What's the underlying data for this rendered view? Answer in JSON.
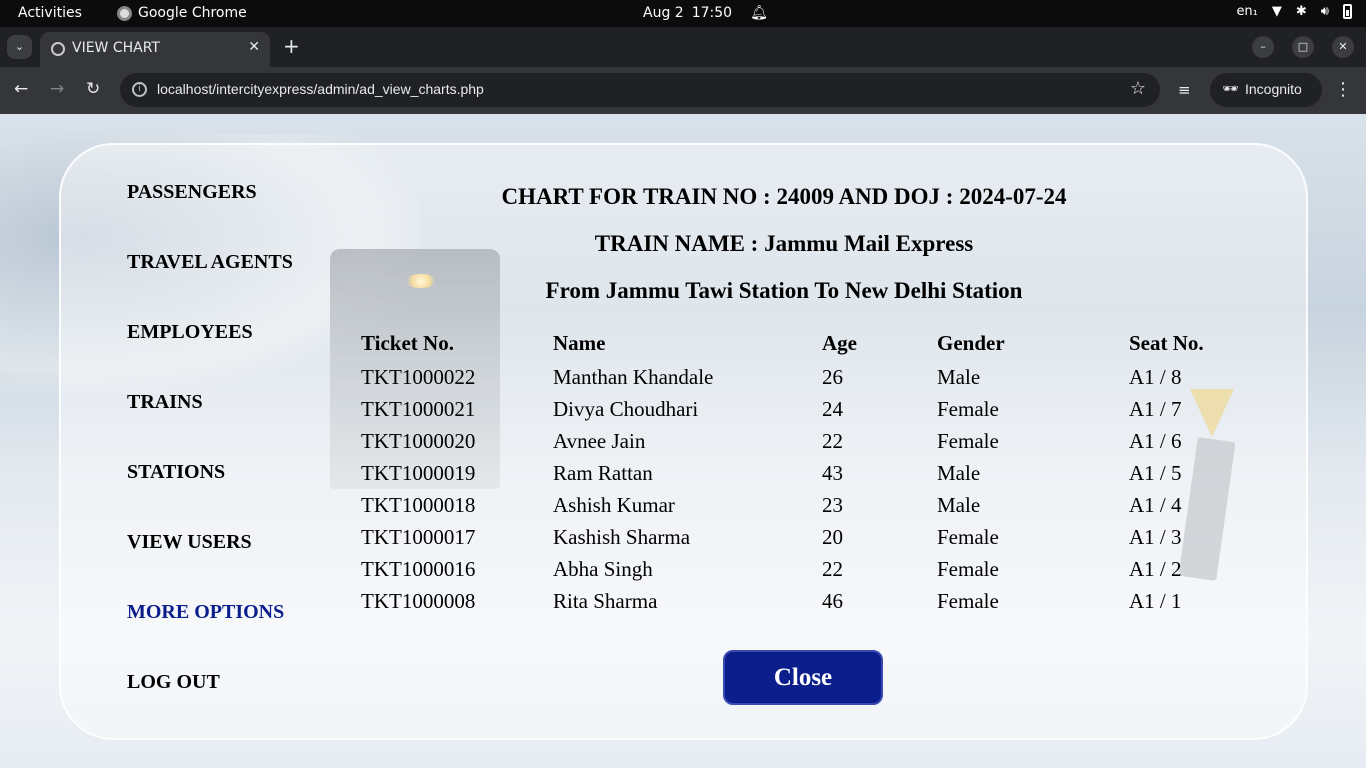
{
  "os": {
    "activities": "Activities",
    "app_name": "Google Chrome",
    "date": "Aug 2",
    "time": "17:50",
    "lang": "en₁"
  },
  "browser": {
    "tab_title": "VIEW CHART",
    "url": "localhost/intercityexpress/admin/ad_view_charts.php",
    "incognito_label": "Incognito"
  },
  "sidebar": {
    "items": [
      {
        "label": "PASSENGERS"
      },
      {
        "label": "TRAVEL AGENTS"
      },
      {
        "label": "EMPLOYEES"
      },
      {
        "label": "TRAINS"
      },
      {
        "label": "STATIONS"
      },
      {
        "label": "VIEW USERS"
      },
      {
        "label": "MORE OPTIONS"
      },
      {
        "label": "LOG OUT"
      }
    ]
  },
  "chart": {
    "heading1": "CHART FOR TRAIN NO : 24009 AND DOJ : 2024-07-24",
    "heading2": "TRAIN NAME : Jammu Mail Express",
    "heading3": "From Jammu Tawi Station To New Delhi Station",
    "columns": [
      "Ticket No.",
      "Name",
      "Age",
      "Gender",
      "Seat No."
    ],
    "rows": [
      [
        "TKT1000022",
        "Manthan Khandale",
        "26",
        "Male",
        "A1 / 8"
      ],
      [
        "TKT1000021",
        "Divya Choudhari",
        "24",
        "Female",
        "A1 / 7"
      ],
      [
        "TKT1000020",
        "Avnee Jain",
        "22",
        "Female",
        "A1 / 6"
      ],
      [
        "TKT1000019",
        "Ram Rattan",
        "43",
        "Male",
        "A1 / 5"
      ],
      [
        "TKT1000018",
        "Ashish Kumar",
        "23",
        "Male",
        "A1 / 4"
      ],
      [
        "TKT1000017",
        "Kashish Sharma",
        "20",
        "Female",
        "A1 / 3"
      ],
      [
        "TKT1000016",
        "Abha Singh",
        "22",
        "Female",
        "A1 / 2"
      ],
      [
        "TKT1000008",
        "Rita Sharma",
        "46",
        "Female",
        "A1 / 1"
      ]
    ],
    "close_label": "Close"
  },
  "colors": {
    "accent": "#0b1e8c",
    "active_link": "#0b1e8c"
  },
  "icons": [
    "chrome-icon",
    "bell-icon",
    "wifi-icon",
    "bluetooth-icon",
    "volume-icon",
    "battery-icon",
    "globe-icon",
    "info-icon",
    "star-icon",
    "incognito-icon"
  ]
}
